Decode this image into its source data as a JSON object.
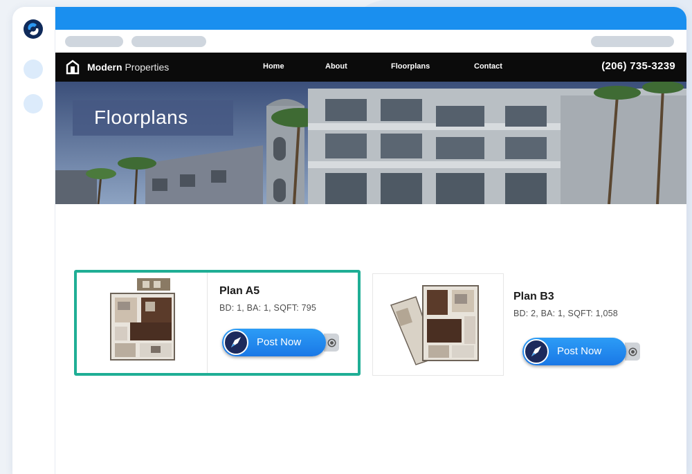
{
  "site": {
    "brand_bold": "Modern",
    "brand_light": " Properties",
    "nav": [
      "Home",
      "About",
      "Floorplans",
      "Contact"
    ],
    "phone": "(206) 735-3239"
  },
  "hero": {
    "title": "Floorplans"
  },
  "plans": [
    {
      "name": "Plan A5",
      "specs": "BD: 1, BA: 1, SQFT: 795",
      "button": "Post Now"
    },
    {
      "name": "Plan B3",
      "specs": "BD: 2, BA: 1, SQFT: 1,058",
      "button": "Post Now"
    }
  ],
  "colors": {
    "accent": "#1a8fef",
    "selection": "#1fae95",
    "nav_bg": "#0b0b0b",
    "button": "#1a78e6"
  },
  "icons": {
    "app_logo": "app-logo-icon",
    "brand": "house-icon",
    "post": "rocket-icon",
    "settings": "gear-icon"
  }
}
